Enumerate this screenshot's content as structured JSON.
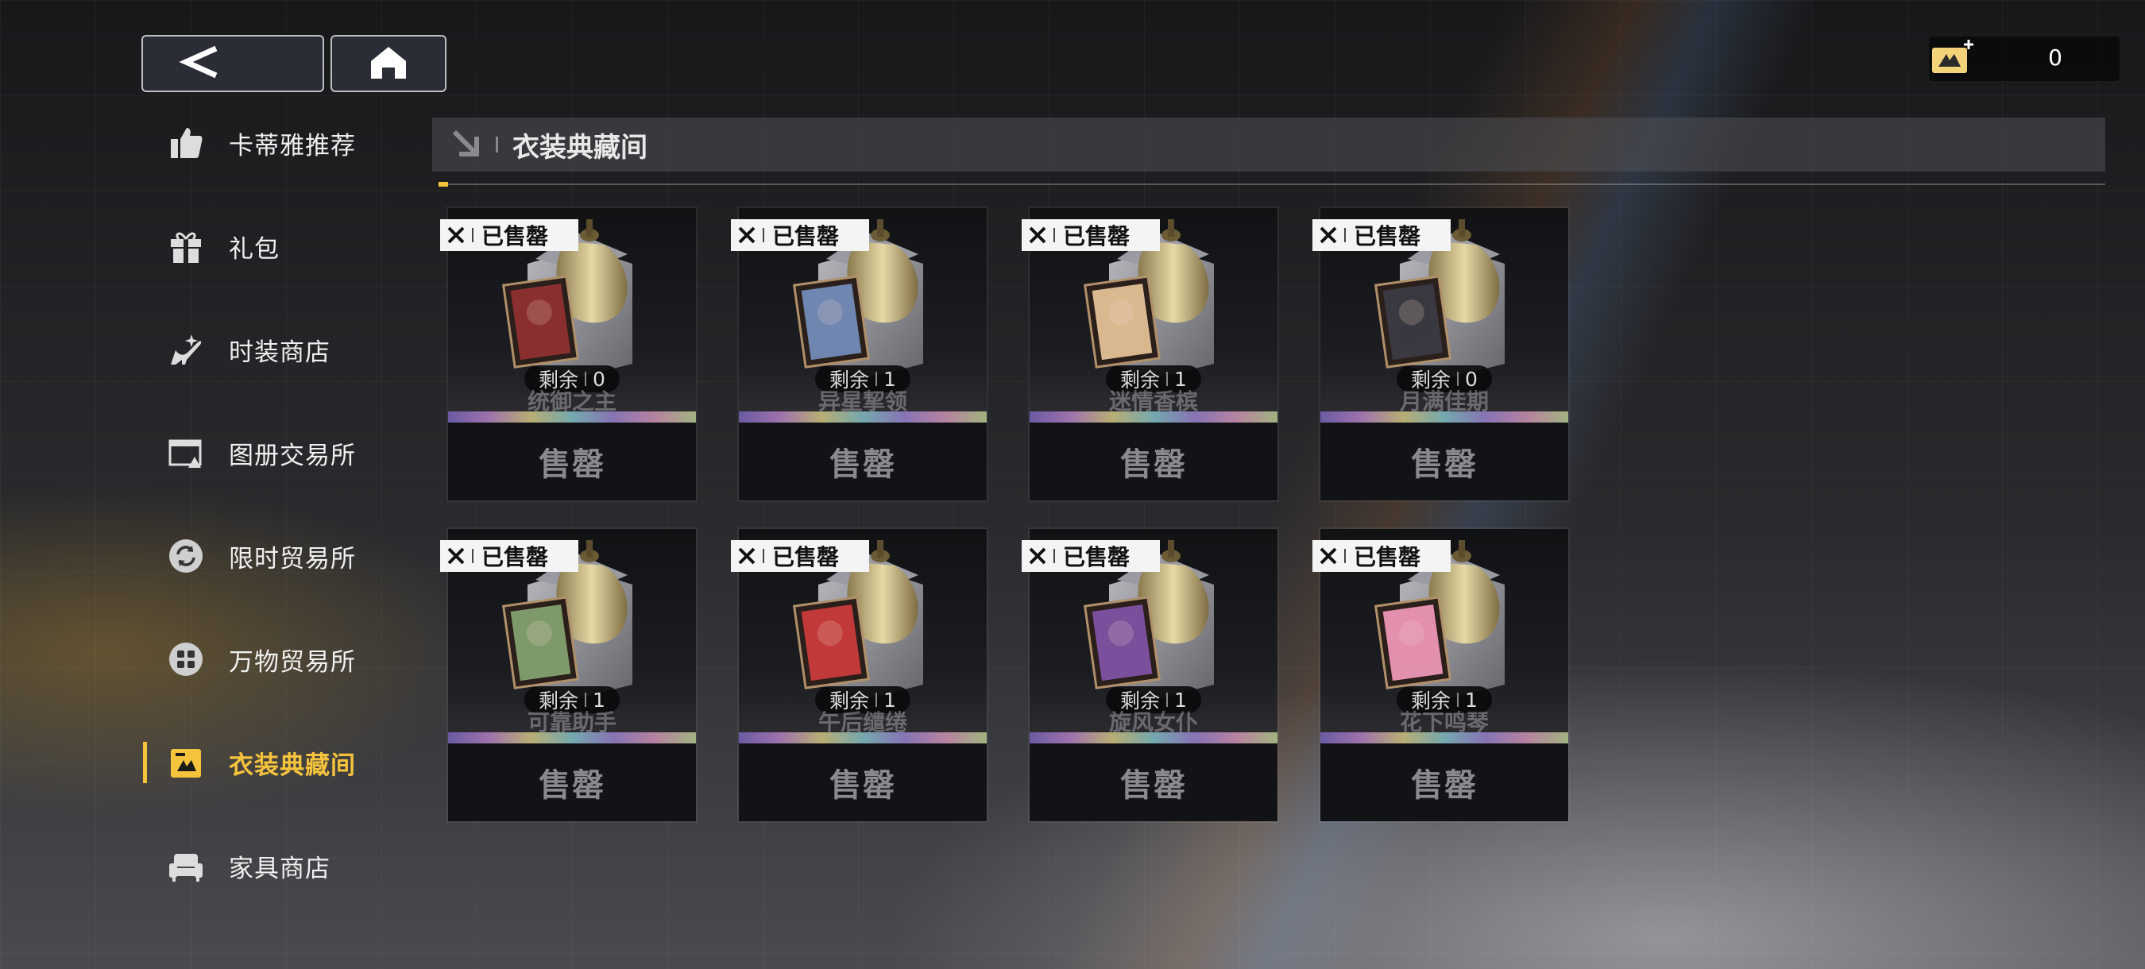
{
  "topbar": {
    "back_icon": "back-arrow-icon",
    "home_icon": "home-icon",
    "currency_icon": "wardrobe-ticket-icon",
    "currency_value": "0"
  },
  "sidebar": {
    "items": [
      {
        "label": "卡蒂雅推荐",
        "icon": "thumbs-up-icon"
      },
      {
        "label": "礼包",
        "icon": "gift-icon"
      },
      {
        "label": "时装商店",
        "icon": "high-heel-icon"
      },
      {
        "label": "图册交易所",
        "icon": "album-exchange-icon"
      },
      {
        "label": "限时贸易所",
        "icon": "refresh-circle-icon"
      },
      {
        "label": "万物贸易所",
        "icon": "grid-circle-icon"
      },
      {
        "label": "衣装典藏间",
        "icon": "wardrobe-collection-icon",
        "active": true
      },
      {
        "label": "家具商店",
        "icon": "sofa-icon"
      }
    ]
  },
  "content": {
    "title": "衣装典藏间",
    "title_icon": "collection-arrow-icon"
  },
  "cards": [
    {
      "name": "统御之主",
      "remaining_label": "剩余",
      "remaining": "0",
      "badge": "已售罄",
      "status": "售罄",
      "accent": "#8a2f2f"
    },
    {
      "name": "异星挈领",
      "remaining_label": "剩余",
      "remaining": "1",
      "badge": "已售罄",
      "status": "售罄",
      "accent": "#6f86b0"
    },
    {
      "name": "迷情香槟",
      "remaining_label": "剩余",
      "remaining": "1",
      "badge": "已售罄",
      "status": "售罄",
      "accent": "#d9b890"
    },
    {
      "name": "月满佳期",
      "remaining_label": "剩余",
      "remaining": "0",
      "badge": "已售罄",
      "status": "售罄",
      "accent": "#3a3840"
    },
    {
      "name": "可靠助手",
      "remaining_label": "剩余",
      "remaining": "1",
      "badge": "已售罄",
      "status": "售罄",
      "accent": "#7f9a6a"
    },
    {
      "name": "午后缱绻",
      "remaining_label": "剩余",
      "remaining": "1",
      "badge": "已售罄",
      "status": "售罄",
      "accent": "#c2393a"
    },
    {
      "name": "旋风女仆",
      "remaining_label": "剩余",
      "remaining": "1",
      "badge": "已售罄",
      "status": "售罄",
      "accent": "#7a4f9c"
    },
    {
      "name": "花下鸣琴",
      "remaining_label": "剩余",
      "remaining": "1",
      "badge": "已售罄",
      "status": "售罄",
      "accent": "#e38fae"
    }
  ]
}
